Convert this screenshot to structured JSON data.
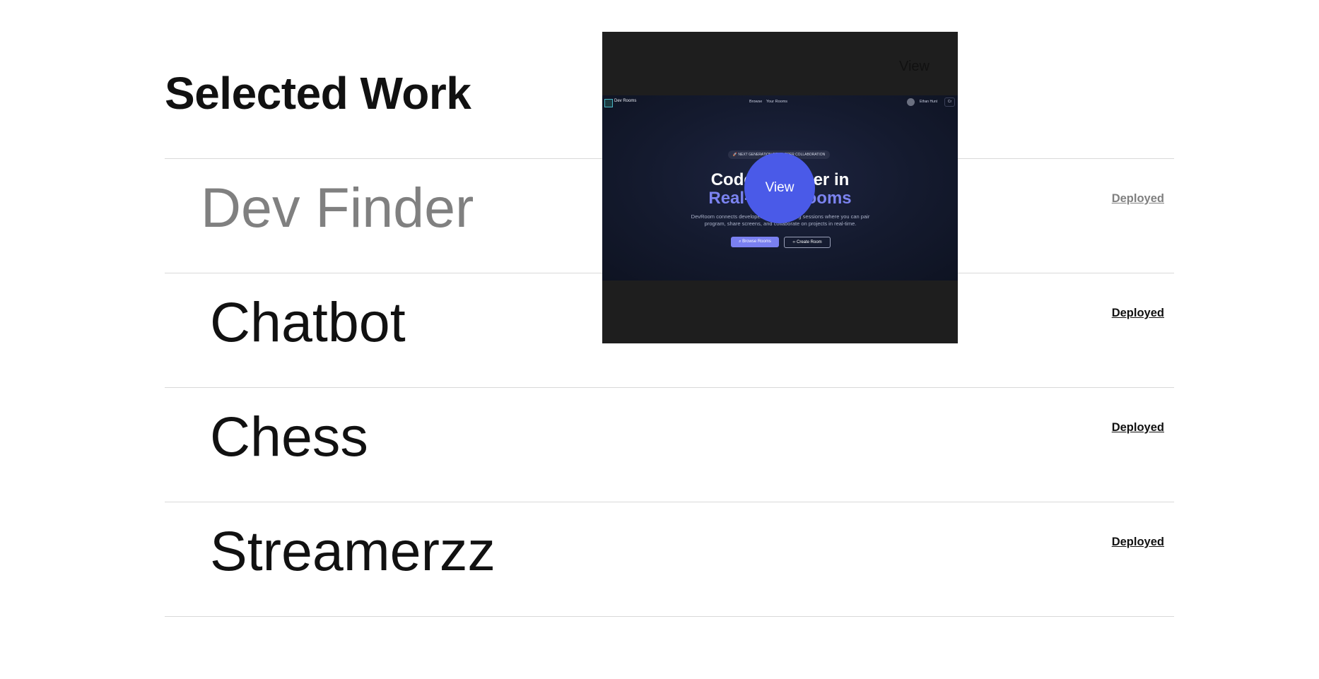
{
  "heading": "Selected Work",
  "projects": [
    {
      "name": "Dev Finder",
      "status": "Deployed"
    },
    {
      "name": "Chatbot",
      "status": "Deployed"
    },
    {
      "name": "Chess",
      "status": "Deployed"
    },
    {
      "name": "Streamerzz",
      "status": "Deployed"
    }
  ],
  "preview": {
    "corner_label": "View",
    "view_button": "View",
    "screenshot": {
      "brand": "Dev Rooms",
      "nav_links": [
        "Browse",
        "Your Rooms"
      ],
      "user": "Ethan Hunt",
      "nav_button": "Cr",
      "badge": "🚀 NEXT GENERATION DEVELOPER COLLABORATION",
      "title_line1": "Code Together in",
      "title_line2": "Real-Time Rooms",
      "description": "DevRoom connects developers through coding sessions where you can pair program, share screens, and collaborate on projects in real-time.",
      "primary_button": "Browse Rooms",
      "secondary_button": "Create Room",
      "colors": {
        "accent": "#7b83f0",
        "view_circle": "#4a5ae8"
      }
    }
  }
}
